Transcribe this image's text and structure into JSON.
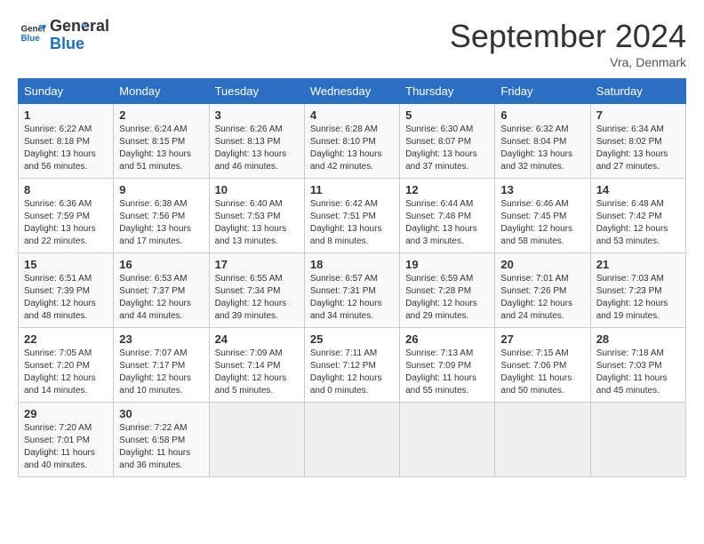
{
  "header": {
    "logo_line1": "General",
    "logo_line2": "Blue",
    "month_title": "September 2024",
    "location": "Vra, Denmark"
  },
  "days_of_week": [
    "Sunday",
    "Monday",
    "Tuesday",
    "Wednesday",
    "Thursday",
    "Friday",
    "Saturday"
  ],
  "weeks": [
    [
      {
        "day": "1",
        "info": "Sunrise: 6:22 AM\nSunset: 8:18 PM\nDaylight: 13 hours\nand 56 minutes."
      },
      {
        "day": "2",
        "info": "Sunrise: 6:24 AM\nSunset: 8:15 PM\nDaylight: 13 hours\nand 51 minutes."
      },
      {
        "day": "3",
        "info": "Sunrise: 6:26 AM\nSunset: 8:13 PM\nDaylight: 13 hours\nand 46 minutes."
      },
      {
        "day": "4",
        "info": "Sunrise: 6:28 AM\nSunset: 8:10 PM\nDaylight: 13 hours\nand 42 minutes."
      },
      {
        "day": "5",
        "info": "Sunrise: 6:30 AM\nSunset: 8:07 PM\nDaylight: 13 hours\nand 37 minutes."
      },
      {
        "day": "6",
        "info": "Sunrise: 6:32 AM\nSunset: 8:04 PM\nDaylight: 13 hours\nand 32 minutes."
      },
      {
        "day": "7",
        "info": "Sunrise: 6:34 AM\nSunset: 8:02 PM\nDaylight: 13 hours\nand 27 minutes."
      }
    ],
    [
      {
        "day": "8",
        "info": "Sunrise: 6:36 AM\nSunset: 7:59 PM\nDaylight: 13 hours\nand 22 minutes."
      },
      {
        "day": "9",
        "info": "Sunrise: 6:38 AM\nSunset: 7:56 PM\nDaylight: 13 hours\nand 17 minutes."
      },
      {
        "day": "10",
        "info": "Sunrise: 6:40 AM\nSunset: 7:53 PM\nDaylight: 13 hours\nand 13 minutes."
      },
      {
        "day": "11",
        "info": "Sunrise: 6:42 AM\nSunset: 7:51 PM\nDaylight: 13 hours\nand 8 minutes."
      },
      {
        "day": "12",
        "info": "Sunrise: 6:44 AM\nSunset: 7:48 PM\nDaylight: 13 hours\nand 3 minutes."
      },
      {
        "day": "13",
        "info": "Sunrise: 6:46 AM\nSunset: 7:45 PM\nDaylight: 12 hours\nand 58 minutes."
      },
      {
        "day": "14",
        "info": "Sunrise: 6:48 AM\nSunset: 7:42 PM\nDaylight: 12 hours\nand 53 minutes."
      }
    ],
    [
      {
        "day": "15",
        "info": "Sunrise: 6:51 AM\nSunset: 7:39 PM\nDaylight: 12 hours\nand 48 minutes."
      },
      {
        "day": "16",
        "info": "Sunrise: 6:53 AM\nSunset: 7:37 PM\nDaylight: 12 hours\nand 44 minutes."
      },
      {
        "day": "17",
        "info": "Sunrise: 6:55 AM\nSunset: 7:34 PM\nDaylight: 12 hours\nand 39 minutes."
      },
      {
        "day": "18",
        "info": "Sunrise: 6:57 AM\nSunset: 7:31 PM\nDaylight: 12 hours\nand 34 minutes."
      },
      {
        "day": "19",
        "info": "Sunrise: 6:59 AM\nSunset: 7:28 PM\nDaylight: 12 hours\nand 29 minutes."
      },
      {
        "day": "20",
        "info": "Sunrise: 7:01 AM\nSunset: 7:26 PM\nDaylight: 12 hours\nand 24 minutes."
      },
      {
        "day": "21",
        "info": "Sunrise: 7:03 AM\nSunset: 7:23 PM\nDaylight: 12 hours\nand 19 minutes."
      }
    ],
    [
      {
        "day": "22",
        "info": "Sunrise: 7:05 AM\nSunset: 7:20 PM\nDaylight: 12 hours\nand 14 minutes."
      },
      {
        "day": "23",
        "info": "Sunrise: 7:07 AM\nSunset: 7:17 PM\nDaylight: 12 hours\nand 10 minutes."
      },
      {
        "day": "24",
        "info": "Sunrise: 7:09 AM\nSunset: 7:14 PM\nDaylight: 12 hours\nand 5 minutes."
      },
      {
        "day": "25",
        "info": "Sunrise: 7:11 AM\nSunset: 7:12 PM\nDaylight: 12 hours\nand 0 minutes."
      },
      {
        "day": "26",
        "info": "Sunrise: 7:13 AM\nSunset: 7:09 PM\nDaylight: 11 hours\nand 55 minutes."
      },
      {
        "day": "27",
        "info": "Sunrise: 7:15 AM\nSunset: 7:06 PM\nDaylight: 11 hours\nand 50 minutes."
      },
      {
        "day": "28",
        "info": "Sunrise: 7:18 AM\nSunset: 7:03 PM\nDaylight: 11 hours\nand 45 minutes."
      }
    ],
    [
      {
        "day": "29",
        "info": "Sunrise: 7:20 AM\nSunset: 7:01 PM\nDaylight: 11 hours\nand 40 minutes."
      },
      {
        "day": "30",
        "info": "Sunrise: 7:22 AM\nSunset: 6:58 PM\nDaylight: 11 hours\nand 36 minutes."
      },
      {
        "day": "",
        "info": ""
      },
      {
        "day": "",
        "info": ""
      },
      {
        "day": "",
        "info": ""
      },
      {
        "day": "",
        "info": ""
      },
      {
        "day": "",
        "info": ""
      }
    ]
  ]
}
